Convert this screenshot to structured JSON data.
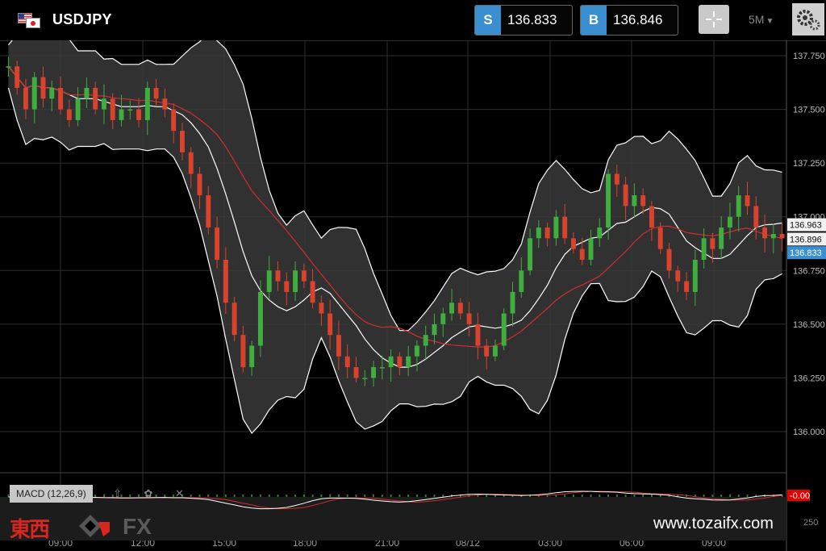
{
  "header": {
    "symbol": "USDJPY",
    "sell_tag": "S",
    "sell_price": "136.833",
    "buy_tag": "B",
    "buy_price": "136.846",
    "timeframe": "5M",
    "timeframe_caret": "▼"
  },
  "indicator": {
    "label": "MACD (12,26,9)",
    "controls": "⇧ ✿ ✕",
    "value_tag": "-0.00",
    "axis_partial": "250"
  },
  "watermark": {
    "kanji": "東西",
    "fx": "FX",
    "url": "www.tozaifx.com"
  },
  "colors": {
    "up": "#3fae3f",
    "down": "#d9432e",
    "band_fill": "#3a3a3a",
    "band_line": "#ffffff",
    "ma": "#d22e2e",
    "grid": "#2e2e2e",
    "sell_tag": "#3a8fd0",
    "last_tag": "#3a8fd0",
    "macd_tag": "#e00000"
  },
  "chart_data": {
    "type": "candlestick",
    "symbol": "USDJPY",
    "timeframe": "5M",
    "y_ticks": [
      "137.750",
      "137.500",
      "137.250",
      "137.000",
      "136.750",
      "136.500",
      "136.250",
      "136.000"
    ],
    "y_tick_values": [
      137.75,
      137.5,
      137.25,
      137.0,
      136.75,
      136.5,
      136.25,
      136.0
    ],
    "ylim": [
      135.8,
      137.8
    ],
    "x_ticks": [
      "09:00",
      "12:00",
      "15:00",
      "18:00",
      "21:00",
      "08/12",
      "03:00",
      "06:00",
      "09:00"
    ],
    "price_tags": [
      {
        "label": "136.963",
        "value": 136.963,
        "style": "plain"
      },
      {
        "label": "136.896",
        "value": 136.896,
        "style": "plain"
      },
      {
        "label": "136.833",
        "value": 136.833,
        "style": "last"
      }
    ],
    "close_path": [
      137.7,
      137.6,
      137.5,
      137.65,
      137.55,
      137.6,
      137.5,
      137.45,
      137.55,
      137.6,
      137.5,
      137.55,
      137.45,
      137.5,
      137.5,
      137.45,
      137.6,
      137.55,
      137.5,
      137.4,
      137.3,
      137.2,
      137.1,
      136.95,
      136.8,
      136.6,
      136.45,
      136.3,
      136.4,
      136.65,
      136.75,
      136.7,
      136.65,
      136.75,
      136.7,
      136.6,
      136.55,
      136.45,
      136.35,
      136.3,
      136.25,
      136.25,
      136.3,
      136.3,
      136.35,
      136.3,
      136.35,
      136.4,
      136.45,
      136.5,
      136.55,
      136.6,
      136.55,
      136.5,
      136.4,
      136.35,
      136.4,
      136.55,
      136.65,
      136.75,
      136.9,
      136.95,
      136.9,
      137.0,
      136.9,
      136.85,
      136.8,
      136.9,
      136.95,
      137.2,
      137.15,
      137.05,
      137.1,
      137.05,
      136.95,
      136.85,
      136.75,
      136.7,
      136.65,
      136.8,
      136.9,
      136.85,
      136.95,
      137.0,
      137.1,
      137.05,
      136.95,
      136.9,
      136.92,
      136.9
    ],
    "bollinger_period": 20,
    "ma_period": 40
  }
}
